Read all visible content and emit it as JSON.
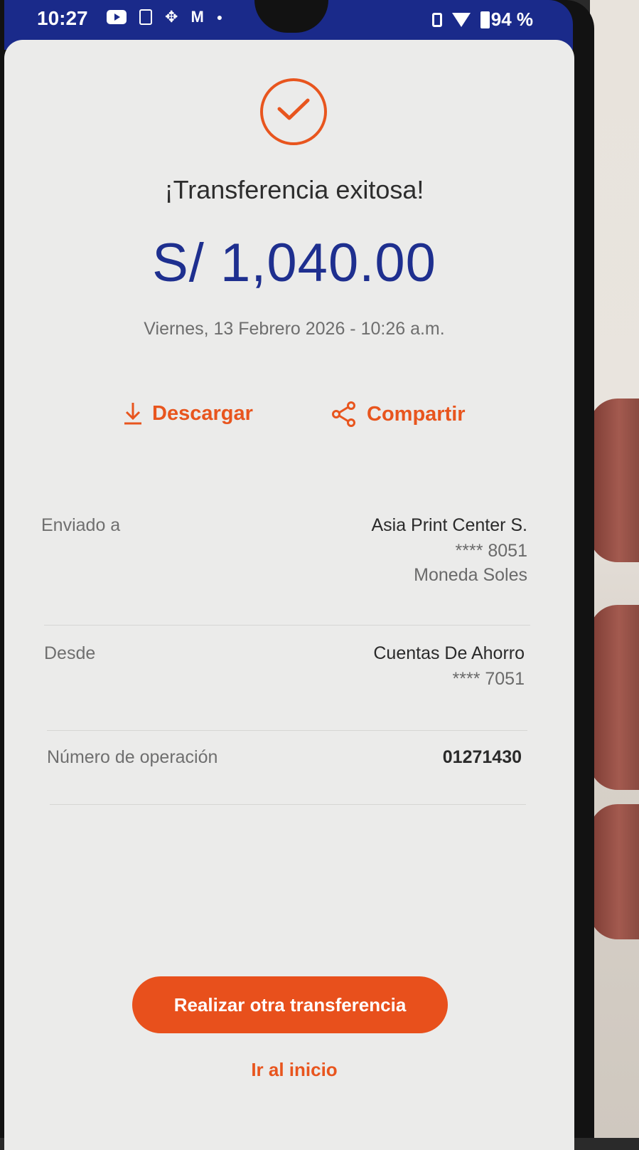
{
  "status_bar": {
    "time": "10:27",
    "battery": "94 %"
  },
  "header": {
    "title": "¡Transferencia exitosa!",
    "amount": "S/ 1,040.00",
    "datetime": "Viernes, 13 Febrero 2026 - 10:26 a.m."
  },
  "actions": {
    "download_label": "Descargar",
    "share_label": "Compartir"
  },
  "details": {
    "sent_to": {
      "label": "Enviado a",
      "name": "Asia Print Center S.",
      "account": "**** 8051",
      "currency": "Moneda Soles"
    },
    "from": {
      "label": "Desde",
      "name": "Cuentas De Ahorro",
      "account": "**** 7051"
    },
    "operation": {
      "label": "Número de operación",
      "number": "01271430"
    }
  },
  "footer": {
    "primary_button": "Realizar otra transferencia",
    "home_link": "Ir al inicio"
  },
  "colors": {
    "accent": "#e8551e",
    "amount": "#1e2f8f",
    "status_bar": "#1a2a8a"
  }
}
